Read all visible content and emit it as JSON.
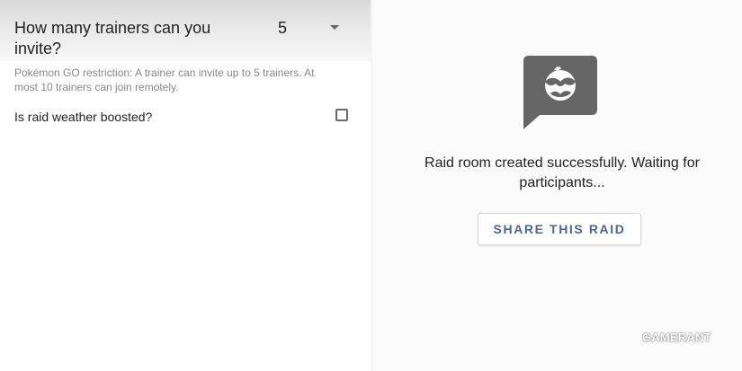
{
  "raid_form": {
    "invite_question": "How many trainers can you invite?",
    "invite_count_value": "5",
    "restriction_note": "Pokémon GO restriction: A trainer can invite up to 5 trainers. At most 10 trainers can join remotely.",
    "weather_question": "Is raid weather boosted?",
    "weather_boosted": false
  },
  "raid_room": {
    "status_message": "Raid room created successfully. Waiting for participants...",
    "share_button_label": "SHARE THIS RAID",
    "icon": "chat-bubble-pokeball-icon"
  },
  "watermark": {
    "text": "GAMERANT"
  },
  "colors": {
    "accent_text": "#4a6596",
    "icon_gray": "#666666"
  }
}
